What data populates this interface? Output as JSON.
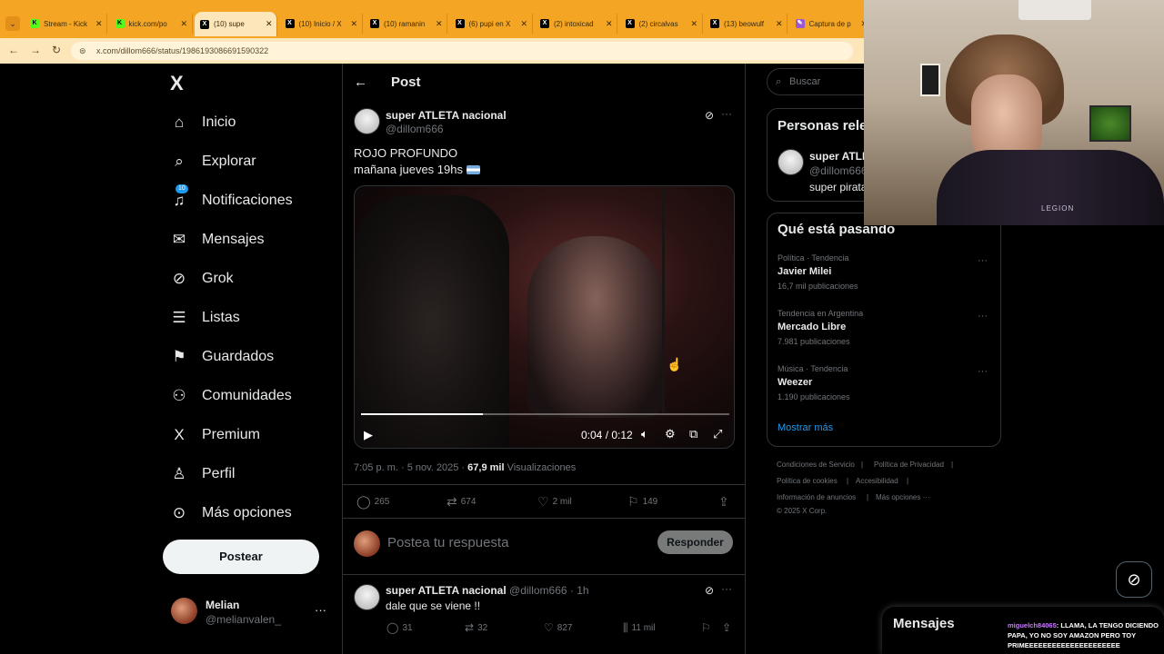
{
  "browser": {
    "tabs": [
      {
        "title": "Stream - Kick",
        "icon": "kick",
        "active": false
      },
      {
        "title": "kick.com/po",
        "icon": "kick",
        "active": false
      },
      {
        "title": "(10) supe",
        "icon": "x",
        "active": true
      },
      {
        "title": "(10) Inicio / X",
        "icon": "x",
        "active": false
      },
      {
        "title": "(10) ramanin",
        "icon": "x",
        "active": false
      },
      {
        "title": "(6) pupi en X",
        "icon": "x",
        "active": false
      },
      {
        "title": "(2) intoxicad",
        "icon": "x",
        "active": false
      },
      {
        "title": "(2) circalvas",
        "icon": "x",
        "active": false
      },
      {
        "title": "(13) beowulf",
        "icon": "x",
        "active": false
      },
      {
        "title": "Captura de p",
        "icon": "pen",
        "active": false
      }
    ],
    "url": "x.com/dillom666/status/1986193086691590322"
  },
  "nav": {
    "logo": "X",
    "items": [
      {
        "label": "Inicio",
        "icon": "home-icon",
        "glyph": "⌂"
      },
      {
        "label": "Explorar",
        "icon": "search-icon",
        "glyph": "⌕"
      },
      {
        "label": "Notificaciones",
        "icon": "bell-icon",
        "glyph": "♫",
        "badge": "10"
      },
      {
        "label": "Mensajes",
        "icon": "mail-icon",
        "glyph": "✉"
      },
      {
        "label": "Grok",
        "icon": "grok-icon",
        "glyph": "⊘"
      },
      {
        "label": "Listas",
        "icon": "list-icon",
        "glyph": "☰"
      },
      {
        "label": "Guardados",
        "icon": "bookmark-icon",
        "glyph": "⚑"
      },
      {
        "label": "Comunidades",
        "icon": "communities-icon",
        "glyph": "⚇"
      },
      {
        "label": "Premium",
        "icon": "x-icon",
        "glyph": "X"
      },
      {
        "label": "Perfil",
        "icon": "user-icon",
        "glyph": "♙"
      },
      {
        "label": "Más opciones",
        "icon": "more-circle-icon",
        "glyph": "⊙"
      }
    ],
    "post_button": "Postear",
    "account": {
      "name": "Melian",
      "handle": "@melianvalen_"
    }
  },
  "post": {
    "header": "Post",
    "author_name": "super ATLETA nacional",
    "author_handle": "@dillom666",
    "text_line1": "ROJO PROFUNDO",
    "text_line2": "mañana jueves 19hs",
    "video": {
      "time": "0:04 / 0:12",
      "progress": 0.33
    },
    "meta_time": "7:05 p. m. · 5 nov. 2025 · ",
    "views_count": "67,9 mil",
    "views_label": " Visualizaciones",
    "stats": {
      "replies": "265",
      "reposts": "674",
      "likes": "2 mil",
      "bookmarks": "149"
    },
    "reply_placeholder": "Postea tu respuesta",
    "reply_button": "Responder"
  },
  "reply": {
    "author_name": "super ATLETA nacional",
    "meta": " @dillom666 · 1h",
    "text": "dale que se viene !!",
    "stats": {
      "replies": "31",
      "reposts": "32",
      "likes": "827",
      "views": "11 mil"
    }
  },
  "sidebar": {
    "search_placeholder": "Buscar",
    "people_title": "Personas rele",
    "person": {
      "name": "super ATLE",
      "handle": "@dillom666",
      "bio": "super pirata"
    },
    "trends_title": "Qué está pasando",
    "trends": [
      {
        "category": "Política · Tendencia",
        "name": "Javier Milei",
        "count": "16,7 mil publicaciones"
      },
      {
        "category": "Tendencia en Argentina",
        "name": "Mercado Libre",
        "count": "7.981 publicaciones"
      },
      {
        "category": "Música · Tendencia",
        "name": "Weezer",
        "count": "1.190 publicaciones"
      }
    ],
    "show_more": "Mostrar más",
    "footer": {
      "terms": "Condiciones de Servicio",
      "privacy": "Política de Privacidad",
      "cookies": "Política de cookies",
      "accessibility": "Accesibilidad",
      "ads": "Información de anuncios",
      "more": "Más opciones ···",
      "copyright": "© 2025 X Corp."
    }
  },
  "webcam": {
    "shirt_text": "LEGION"
  },
  "messages_drawer": {
    "title": "Mensajes"
  },
  "chat_overlay": {
    "user": "miguelch84065",
    "message": ": LLAMA, LA TENGO DICIENDO PAPA, YO NO SOY AMAZON PERO TOY PRIMEEEEEEEEEEEEEEEEEEEEE"
  }
}
